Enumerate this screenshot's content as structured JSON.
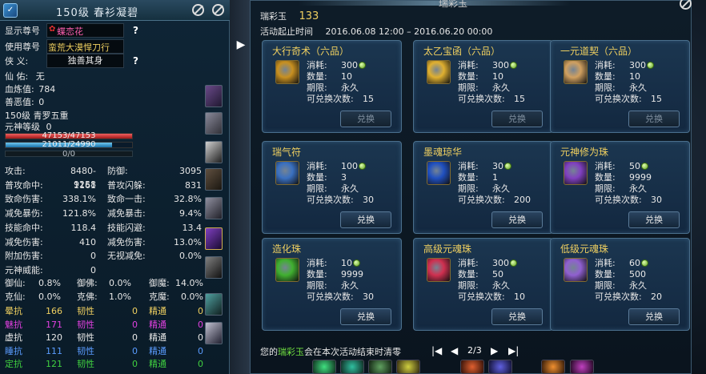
{
  "char": {
    "title": "150级 春衫凝碧",
    "rows": {
      "display_title": {
        "label": "显示尊号",
        "value": "蝶恋花"
      },
      "use_title": {
        "label": "使用尊号",
        "value": "蛮荒大漠悍刀行"
      },
      "xiayi": {
        "label": "侠    义:",
        "value": "独善其身"
      },
      "xianyin": {
        "label": "仙    佑:",
        "value": "无"
      },
      "xuesha": {
        "label": "血炼值:",
        "value": "784"
      },
      "shane": {
        "label": "善恶值:",
        "value": "0"
      },
      "level": {
        "value": "150级 青罗五重"
      },
      "yuanshen": {
        "label": "元神等级",
        "value": "0"
      }
    },
    "hp_text": "47153/47153",
    "mp_text": "21011/24990",
    "xp_text": "0/0",
    "stats": [
      {
        "l1": "攻击:",
        "v1": "8480-9258",
        "l2": "防御:",
        "v2": "3095"
      },
      {
        "l1": "普攻命中:",
        "v1": "1161",
        "l2": "普攻闪躲:",
        "v2": "831"
      },
      {
        "l1": "致命伤害:",
        "v1": "338.1%",
        "l2": "致命一击:",
        "v2": "32.8%"
      },
      {
        "l1": "减免暴伤:",
        "v1": "121.8%",
        "l2": "减免暴击:",
        "v2": "9.4%"
      },
      {
        "l1": "技能命中:",
        "v1": "118.4",
        "l2": "技能闪避:",
        "v2": "13.4"
      },
      {
        "l1": "减免伤害:",
        "v1": "410",
        "l2": "减免伤害:",
        "v2": "13.0%"
      },
      {
        "l1": "附加伤害:",
        "v1": "0",
        "l2": "无视减免:",
        "v2": "0.0%"
      },
      {
        "l1": "元神威能:",
        "v1": "0",
        "l2": "",
        "v2": ""
      }
    ],
    "magic": [
      {
        "a": "御仙:",
        "av": "0.8%",
        "b": "御佛:",
        "bv": "0.0%",
        "c": "御魔:",
        "cv": "14.0%"
      },
      {
        "a": "克仙:",
        "av": "0.0%",
        "b": "克佛:",
        "bv": "1.0%",
        "c": "克魔:",
        "cv": "0.0%"
      }
    ],
    "resist": [
      {
        "a": "晕抗",
        "av": "166",
        "b": "韧性",
        "bv": "0",
        "c": "精通",
        "cv": "0",
        "col": "#f0d060"
      },
      {
        "a": "魅抗",
        "av": "171",
        "b": "韧性",
        "bv": "0",
        "c": "精通",
        "cv": "0",
        "col": "#e040e0"
      },
      {
        "a": "虚抗",
        "av": "120",
        "b": "韧性",
        "bv": "0",
        "c": "精通",
        "cv": "0",
        "col": "#e8e8e8"
      },
      {
        "a": "睡抗",
        "av": "111",
        "b": "韧性",
        "bv": "0",
        "c": "精通",
        "cv": "0",
        "col": "#5a9cff"
      },
      {
        "a": "定抗",
        "av": "121",
        "b": "韧性",
        "bv": "0",
        "c": "精通",
        "cv": "0",
        "col": "#40d040"
      }
    ]
  },
  "exchange": {
    "title": "瑞彩玉",
    "title_partial": "瑞彩玉",
    "currency_label": "瑞彩玉",
    "currency_value": "133",
    "period_label": "活动起止时间",
    "period_value": "2016.06.08 12:00 – 2016.06.20 00:00",
    "k_cost": "消耗:",
    "k_qty": "数量:",
    "k_term": "期限:",
    "k_times": "可兑换次数:",
    "items": [
      {
        "name": "大行奇术（六品）",
        "cost": "300",
        "qty": "10",
        "term": "永久",
        "times": "15",
        "btn": "兑换",
        "enabled": false,
        "icon_color": "#c89020"
      },
      {
        "name": "太乙宝函（六品）",
        "cost": "300",
        "qty": "10",
        "term": "永久",
        "times": "15",
        "btn": "兑换",
        "enabled": false,
        "icon_color": "#e0b030"
      },
      {
        "name": "一元道契（六品）",
        "cost": "300",
        "qty": "10",
        "term": "永久",
        "times": "15",
        "btn": "兑换",
        "enabled": false,
        "icon_color": "#d0a060"
      },
      {
        "name": "瑞气符",
        "cost": "100",
        "qty": "3",
        "term": "永久",
        "times": "30",
        "btn": "兑换",
        "enabled": true,
        "icon_color": "#3a70c0"
      },
      {
        "name": "墨魂琼华",
        "cost": "30",
        "qty": "1",
        "term": "永久",
        "times": "200",
        "btn": "兑换",
        "enabled": true,
        "icon_color": "#2050c0"
      },
      {
        "name": "元神修为珠",
        "cost": "50",
        "qty": "9999",
        "term": "永久",
        "times": "30",
        "btn": "兑换",
        "enabled": true,
        "icon_color": "#8040c0"
      },
      {
        "name": "造化珠",
        "cost": "10",
        "qty": "9999",
        "term": "永久",
        "times": "30",
        "btn": "兑换",
        "enabled": true,
        "icon_color": "#40b030"
      },
      {
        "name": "高级元魂珠",
        "cost": "300",
        "qty": "50",
        "term": "永久",
        "times": "10",
        "btn": "兑换",
        "enabled": true,
        "icon_color": "#d03050"
      },
      {
        "name": "低级元魂珠",
        "cost": "60",
        "qty": "500",
        "term": "永久",
        "times": "20",
        "btn": "兑换",
        "enabled": true,
        "icon_color": "#9060d0"
      }
    ],
    "footer_pre": "您的",
    "footer_hl": "瑞彩玉",
    "footer_post": "会在本次活动结束时清零",
    "page": "2/3"
  }
}
